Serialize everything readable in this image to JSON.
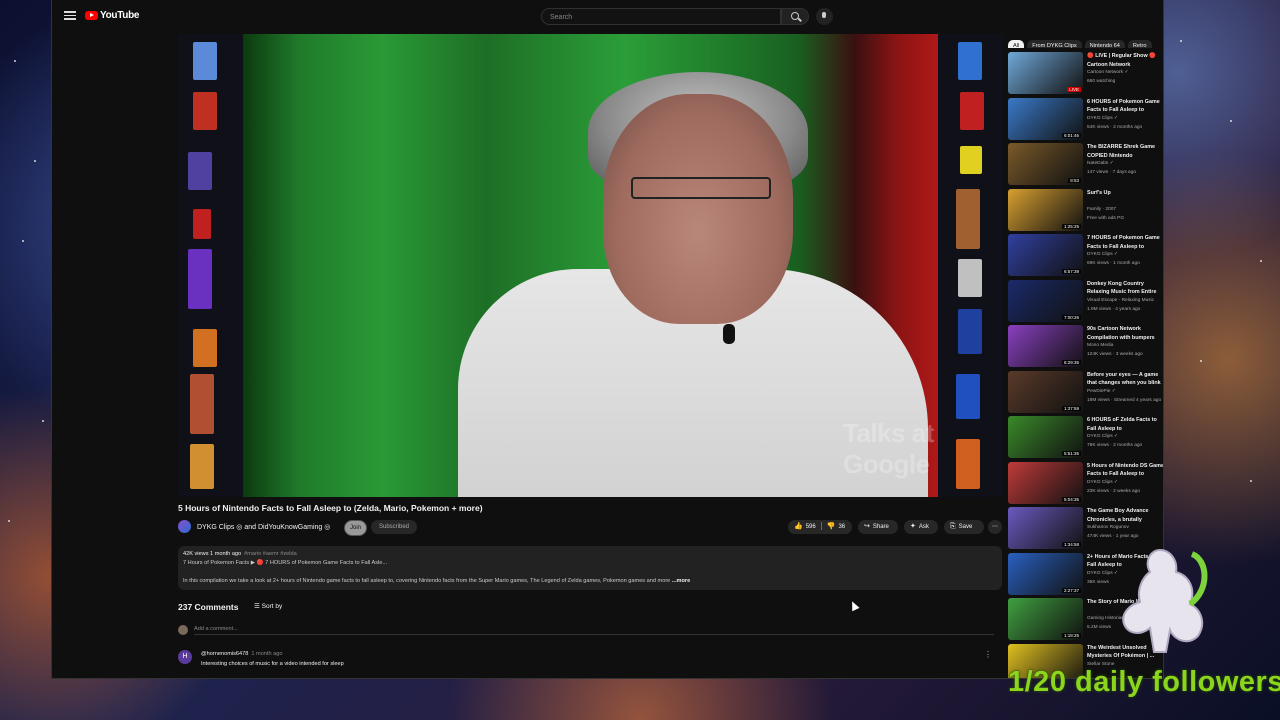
{
  "app": {
    "brand": "YouTube",
    "search_placeholder": "Search"
  },
  "video": {
    "title": "5 Hours of Nintendo Facts to Fall Asleep to (Zelda, Mario, Pokemon + more)",
    "watermark": "Talks at Google",
    "channel": "DYKG Clips ◎ and DidYouKnowGaming ◎",
    "join_label": "Join",
    "subscribed_label": "Subscribed",
    "likes": "596",
    "dislikes": "36",
    "share_label": "Share",
    "ask_label": "Ask",
    "save_label": "Save"
  },
  "description": {
    "meta": "42K views  1 month ago",
    "tags": "#mario #aemr #zelda",
    "line2": "7 Hours of Pokemon Facts ▶  🔴 7 HOURS of Pokemon Game Facts to Fall Asle...",
    "line3": "In this compilation we take a look at 2+ hours of Nintendo game facts to fall asleep to, covering Nintendo facts from the Super Mario games, The Legend of Zelda games, Pokemon games and more",
    "more": "...more"
  },
  "comments": {
    "count_label": "237 Comments",
    "sort_label": "Sort by",
    "add_placeholder": "Add a comment...",
    "items": [
      {
        "avatar": "H",
        "author": "@hornenomis6478",
        "time": "1 month ago",
        "text": "Interesting choices of music for a video intended for sleep"
      }
    ]
  },
  "chips": [
    "All",
    "From DYKG Clips",
    "Nintendo 64",
    "Retro"
  ],
  "recommendations": [
    {
      "title": "🔴 LIVE | Regular Show 🔴 Cartoon Network",
      "channel": "Cartoon Network ✓",
      "meta": "660 watching",
      "badge": "LIVE",
      "thumb": "#6fa9d8"
    },
    {
      "title": "6 HOURS of Pokemon Game Facts to Fall Asleep to",
      "channel": "DYKG Clips ✓",
      "meta": "54K views · 2 months ago",
      "badge": "6:01:46",
      "thumb": "#3a7ac8"
    },
    {
      "title": "The BIZARRE Shrek Game COPIED Nintendo",
      "channel": "NateDabs ✓",
      "meta": "147 views · 7 days ago",
      "badge": "8:53",
      "thumb": "#7a5a2a"
    },
    {
      "title": "Surf's Up",
      "channel": "Family · 2007",
      "meta": "Free with ads  PG",
      "badge": "1:25:25",
      "thumb": "#d8a030"
    },
    {
      "title": "7 HOURS of Pokemon Game Facts to Fall Asleep to",
      "channel": "DYKG Clips ✓",
      "meta": "69K views · 1 month ago",
      "badge": "6:57:39",
      "thumb": "#3040a0"
    },
    {
      "title": "Donkey Kong Country Relaxing Music from Entire Series",
      "channel": "Visual Escape - Relaxing Music",
      "meta": "1.9M views · 4 years ago",
      "badge": "7:00:26",
      "thumb": "#1a2a6a"
    },
    {
      "title": "90s Cartoon Network Compilation with bumpers",
      "channel": "Mono Media",
      "meta": "124K views · 3 weeks ago",
      "badge": "6:29:35",
      "thumb": "#8a40c0"
    },
    {
      "title": "Before your eyes — A game that changes when you blink",
      "channel": "PewDiePie ✓",
      "meta": "18M views · Streamed 4 years ago",
      "badge": "1:37:59",
      "thumb": "#5a3a2a"
    },
    {
      "title": "6 HOURS oF Zelda Facts to Fall Asleep to",
      "channel": "DYKG Clips ✓",
      "meta": "78K views · 2 months ago",
      "badge": "5:51:35",
      "thumb": "#3a8a2a"
    },
    {
      "title": "5 Hours of Nintendo DS Game Facts to Fall Asleep to",
      "channel": "DYKG Clips ✓",
      "meta": "23K views · 2 weeks ago",
      "badge": "5:04:35",
      "thumb": "#c03a3a"
    },
    {
      "title": "The Game Boy Advance Chronicles, a brutally sacrifice",
      "channel": "Sukhanov Rogunov",
      "meta": "474K views · 1 year ago",
      "badge": "1:34:58",
      "thumb": "#6a5ac0"
    },
    {
      "title": "2+ Hours of Mario Facts to Fall Asleep to",
      "channel": "DYKG Clips ✓",
      "meta": "35K views",
      "badge": "2:27:37",
      "thumb": "#2a60c0"
    },
    {
      "title": "The Story of Mario World",
      "channel": "Gaming Historian",
      "meta": "5.2M views",
      "badge": "1:18:25",
      "thumb": "#40a040"
    },
    {
      "title": "The Weirdest Unsolved Mysteries Of Pokémon | ...",
      "channel": "Stellar Stone",
      "meta": "",
      "badge": "",
      "thumb": "#e0c020"
    }
  ],
  "overlay": {
    "followers_text": "1/20 daily followers"
  },
  "colors": {
    "brand_red": "#ff0000",
    "overlay_green": "#8bd61c",
    "page_bg": "#0f0f0f"
  }
}
